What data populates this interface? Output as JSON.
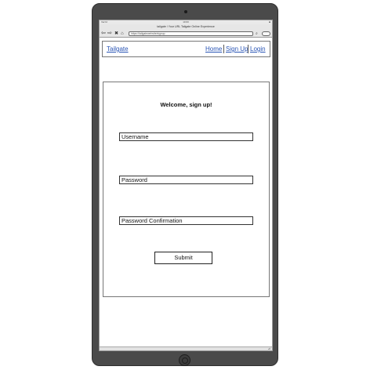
{
  "status_bar": {
    "carrier": "Verzd",
    "time": "10:00",
    "battery": "■"
  },
  "browser": {
    "title": "tailgate / Your URL Tailgate Online Experience",
    "address": "https://tailgatewebsite/signup",
    "icons": {
      "back": "arrow-left-icon",
      "forward": "arrow-right-icon",
      "stop": "close-icon",
      "home": "home-icon"
    }
  },
  "navbar": {
    "brand": "Tailgate",
    "links": [
      "Home",
      "Sign Up",
      "Login"
    ]
  },
  "form": {
    "title": "Welcome, sign up!",
    "username_placeholder": "Username",
    "password_placeholder": "Password",
    "password_confirmation_placeholder": "Password Confirmation",
    "submit_label": "Submit"
  }
}
